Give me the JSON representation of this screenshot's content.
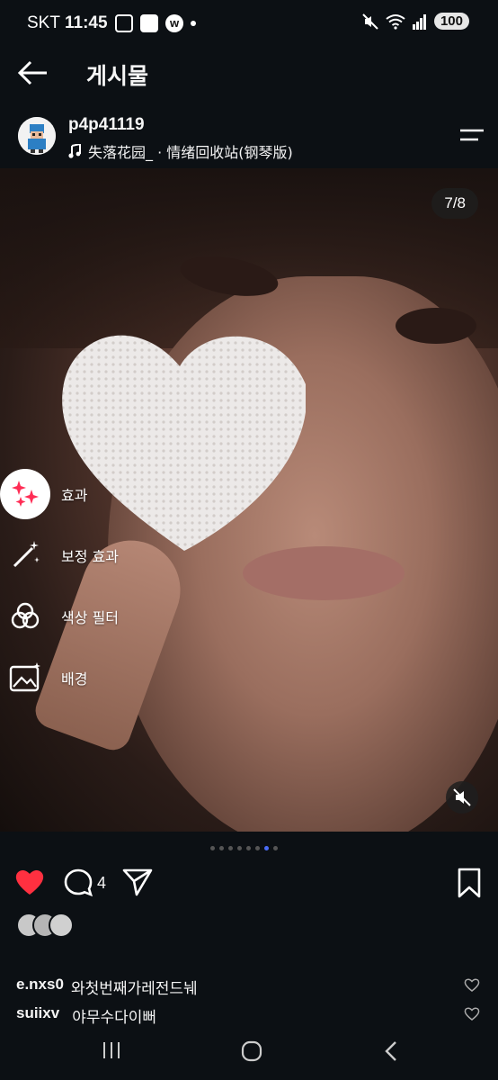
{
  "status_bar": {
    "carrier": "SKT",
    "time": "11:45",
    "battery": "100"
  },
  "header": {
    "title": "게시물"
  },
  "post": {
    "username": "p4p41119",
    "music": "失落花园_ · 情绪回收站(钢琴版)",
    "media_counter": "7/8",
    "carousel_total": 8,
    "carousel_active": 7
  },
  "effects_menu": {
    "items": [
      {
        "label": "효과",
        "icon": "sparkles-icon"
      },
      {
        "label": "보정 효과",
        "icon": "magic-wand-icon"
      },
      {
        "label": "색상 필터",
        "icon": "color-filter-icon"
      },
      {
        "label": "배경",
        "icon": "image-icon"
      }
    ]
  },
  "actions": {
    "liked": true,
    "comment_count": "4"
  },
  "comments": [
    {
      "user": "e.nxs0",
      "text": "와첫번째가레전드눼"
    },
    {
      "user": "suiixv",
      "text": "야무수다이뻐"
    }
  ],
  "colors": {
    "background": "#0c1014",
    "like_red": "#ff3040",
    "accent_blue": "#4a6cf7"
  }
}
